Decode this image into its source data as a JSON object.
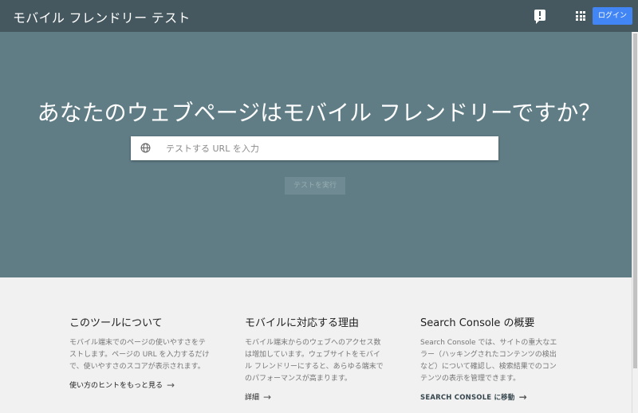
{
  "header": {
    "title": "モバイル フレンドリー テスト",
    "login_label": "ログイン",
    "icons": [
      "feedback-icon",
      "apps-grid-icon"
    ]
  },
  "hero": {
    "heading": "あなたのウェブページはモバイル フレンドリーですか？",
    "url_placeholder": "テストする URL を入力",
    "url_value": "",
    "run_button": "テストを実行"
  },
  "info": {
    "columns": [
      {
        "title": "このツールについて",
        "body": "モバイル端末でのページの使いやすさをテストします。ページの URL を入力するだけで、使いやすさのスコアが表示されます。",
        "link": "使い方のヒントをもっと見る"
      },
      {
        "title": "モバイルに対応する理由",
        "body": "モバイル端末からのウェブへのアクセス数は増加しています。ウェブサイトをモバイル フレンドリーにすると、あらゆる端末でのパフォーマンスが高まります。",
        "link": "詳細"
      },
      {
        "title": "Search Console の概要",
        "body": "Search Console では、サイトの重大なエラー（ハッキングされたコンテンツの検出など）について確認し、検索結果でのコンテンツの表示を管理できます。",
        "link": "SEARCH CONSOLE に移動"
      }
    ]
  },
  "colors": {
    "topbar": "#45585f",
    "hero": "#607d86",
    "login": "#4285f4",
    "info_bg": "#f1f1f1"
  }
}
